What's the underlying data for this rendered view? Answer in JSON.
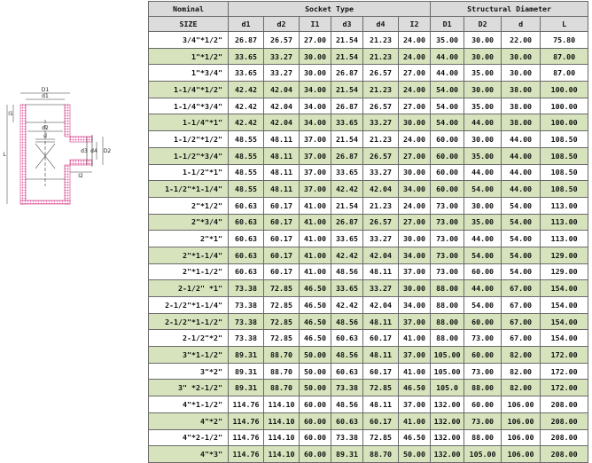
{
  "header": {
    "nominal": "Nominal",
    "size": "SIZE",
    "socket_type": "Socket Type",
    "structural_diameter": "Structural Diameter",
    "columns": [
      "d1",
      "d2",
      "I1",
      "d3",
      "d4",
      "I2",
      "D1",
      "D2",
      "d",
      "L"
    ]
  },
  "diagram_labels": {
    "D1": "D1",
    "d1": "d1",
    "d2": "d2",
    "d": "d",
    "d3": "d3",
    "D2": "D2",
    "d4": "d4",
    "I1": "I1",
    "I2": "I2",
    "L": "L"
  },
  "colors": {
    "header_bg": "#dadada",
    "alt_row_bg": "#d6e3bc",
    "pipe_wall": "#e74b9b"
  },
  "rows": [
    [
      "3/4\"*1/2\"",
      "26.87",
      "26.57",
      "27.00",
      "21.54",
      "21.23",
      "24.00",
      "35.00",
      "30.00",
      "22.00",
      "75.80"
    ],
    [
      "1\"*1/2\"",
      "33.65",
      "33.27",
      "30.00",
      "21.54",
      "21.23",
      "24.00",
      "44.00",
      "30.00",
      "30.00",
      "87.00"
    ],
    [
      "1\"*3/4\"",
      "33.65",
      "33.27",
      "30.00",
      "26.87",
      "26.57",
      "27.00",
      "44.00",
      "35.00",
      "30.00",
      "87.00"
    ],
    [
      "1-1/4\"*1/2\"",
      "42.42",
      "42.04",
      "34.00",
      "21.54",
      "21.23",
      "24.00",
      "54.00",
      "30.00",
      "38.00",
      "100.00"
    ],
    [
      "1-1/4\"*3/4\"",
      "42.42",
      "42.04",
      "34.00",
      "26.87",
      "26.57",
      "27.00",
      "54.00",
      "35.00",
      "38.00",
      "100.00"
    ],
    [
      "1-1/4\"*1\"",
      "42.42",
      "42.04",
      "34.00",
      "33.65",
      "33.27",
      "30.00",
      "54.00",
      "44.00",
      "38.00",
      "100.00"
    ],
    [
      "1-1/2\"*1/2\"",
      "48.55",
      "48.11",
      "37.00",
      "21.54",
      "21.23",
      "24.00",
      "60.00",
      "30.00",
      "44.00",
      "108.50"
    ],
    [
      "1-1/2\"*3/4\"",
      "48.55",
      "48.11",
      "37.00",
      "26.87",
      "26.57",
      "27.00",
      "60.00",
      "35.00",
      "44.00",
      "108.50"
    ],
    [
      "1-1/2\"*1\"",
      "48.55",
      "48.11",
      "37.00",
      "33.65",
      "33.27",
      "30.00",
      "60.00",
      "44.00",
      "44.00",
      "108.50"
    ],
    [
      "1-1/2\"*1-1/4\"",
      "48.55",
      "48.11",
      "37.00",
      "42.42",
      "42.04",
      "34.00",
      "60.00",
      "54.00",
      "44.00",
      "108.50"
    ],
    [
      "2\"*1/2\"",
      "60.63",
      "60.17",
      "41.00",
      "21.54",
      "21.23",
      "24.00",
      "73.00",
      "30.00",
      "54.00",
      "113.00"
    ],
    [
      "2\"*3/4\"",
      "60.63",
      "60.17",
      "41.00",
      "26.87",
      "26.57",
      "27.00",
      "73.00",
      "35.00",
      "54.00",
      "113.00"
    ],
    [
      "2\"*1\"",
      "60.63",
      "60.17",
      "41.00",
      "33.65",
      "33.27",
      "30.00",
      "73.00",
      "44.00",
      "54.00",
      "113.00"
    ],
    [
      "2\"*1-1/4\"",
      "60.63",
      "60.17",
      "41.00",
      "42.42",
      "42.04",
      "34.00",
      "73.00",
      "54.00",
      "54.00",
      "129.00"
    ],
    [
      "2\"*1-1/2\"",
      "60.63",
      "60.17",
      "41.00",
      "48.56",
      "48.11",
      "37.00",
      "73.00",
      "60.00",
      "54.00",
      "129.00"
    ],
    [
      "2-1/2\" *1\"",
      "73.38",
      "72.85",
      "46.50",
      "33.65",
      "33.27",
      "30.00",
      "88.00",
      "44.00",
      "67.00",
      "154.00"
    ],
    [
      "2-1/2\"*1-1/4\"",
      "73.38",
      "72.85",
      "46.50",
      "42.42",
      "42.04",
      "34.00",
      "88.00",
      "54.00",
      "67.00",
      "154.00"
    ],
    [
      "2-1/2\"*1-1/2\"",
      "73.38",
      "72.85",
      "46.50",
      "48.56",
      "48.11",
      "37.00",
      "88.00",
      "60.00",
      "67.00",
      "154.00"
    ],
    [
      "2-1/2\"*2\"",
      "73.38",
      "72.85",
      "46.50",
      "60.63",
      "60.17",
      "41.00",
      "88.00",
      "73.00",
      "67.00",
      "154.00"
    ],
    [
      "3\"*1-1/2\"",
      "89.31",
      "88.70",
      "50.00",
      "48.56",
      "48.11",
      "37.00",
      "105.00",
      "60.00",
      "82.00",
      "172.00"
    ],
    [
      "3\"*2\"",
      "89.31",
      "88.70",
      "50.00",
      "60.63",
      "60.17",
      "41.00",
      "105.00",
      "73.00",
      "82.00",
      "172.00"
    ],
    [
      "3\" *2-1/2\"",
      "89.31",
      "88.70",
      "50.00",
      "73.38",
      "72.85",
      "46.50",
      "105.0",
      "88.00",
      "82.00",
      "172.00"
    ],
    [
      "4\"*1-1/2\"",
      "114.76",
      "114.10",
      "60.00",
      "48.56",
      "48.11",
      "37.00",
      "132.00",
      "60.00",
      "106.00",
      "208.00"
    ],
    [
      "4\"*2\"",
      "114.76",
      "114.10",
      "60.00",
      "60.63",
      "60.17",
      "41.00",
      "132.00",
      "73.00",
      "106.00",
      "208.00"
    ],
    [
      "4\"*2-1/2\"",
      "114.76",
      "114.10",
      "60.00",
      "73.38",
      "72.85",
      "46.50",
      "132.00",
      "88.00",
      "106.00",
      "208.00"
    ],
    [
      "4\"*3\"",
      "114.76",
      "114.10",
      "60.00",
      "89.31",
      "88.70",
      "50.00",
      "132.00",
      "105.00",
      "106.00",
      "208.00"
    ]
  ]
}
